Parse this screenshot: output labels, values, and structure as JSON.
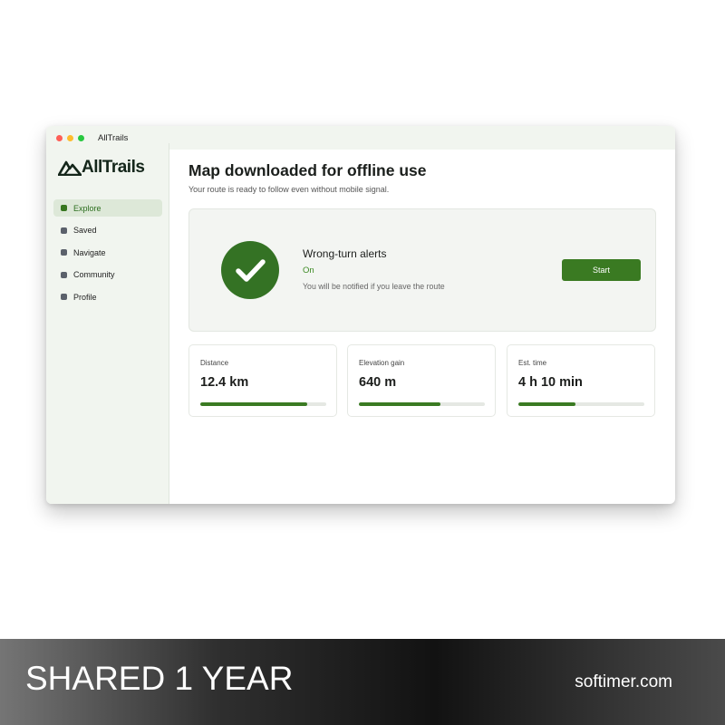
{
  "window": {
    "title": "AllTrails"
  },
  "logo": {
    "text": "AllTrails",
    "icon": "mountain-logo-icon"
  },
  "sidebar": {
    "items": [
      {
        "label": "Explore",
        "active": true
      },
      {
        "label": "Saved",
        "active": false
      },
      {
        "label": "Navigate",
        "active": false
      },
      {
        "label": "Community",
        "active": false
      },
      {
        "label": "Profile",
        "active": false
      }
    ]
  },
  "main": {
    "title": "Map downloaded for offline use",
    "subtitle": "Your route is ready to follow even without mobile signal.",
    "alert": {
      "title": "Wrong-turn alerts",
      "status": "On",
      "description": "You will be notified if you leave the route",
      "button_label": "Start",
      "icon": "checkmark-icon"
    },
    "stats": [
      {
        "label": "Distance",
        "value": "12.4 km",
        "progress": 0.85
      },
      {
        "label": "Elevation gain",
        "value": "640 m",
        "progress": 0.65
      },
      {
        "label": "Est. time",
        "value": "4 h 10 min",
        "progress": 0.45
      }
    ]
  },
  "banner": {
    "left_text": "SHARED 1 YEAR",
    "right_text": "softimer.com"
  },
  "colors": {
    "brand_green": "#3a7a22",
    "sidebar_bg": "#f1f5ef",
    "active_nav_bg": "#dde8d8"
  }
}
